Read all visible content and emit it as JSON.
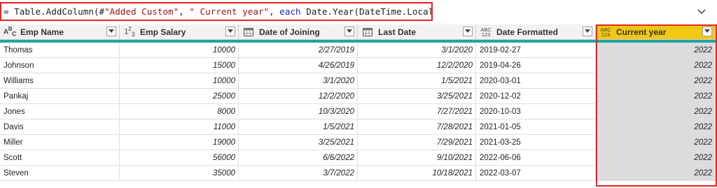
{
  "formula": {
    "prefix": "= Table.AddColumn(#",
    "str1": "\"Added Custom\"",
    "mid1": ", ",
    "str2": "\" Current year\"",
    "mid2": ", ",
    "kw": "each",
    "rest": " Date.Year(DateTime.LocalNow()))",
    "expand_icon": "chevron-down-icon"
  },
  "columns": [
    {
      "label": "Emp Name",
      "type_icon": "ABC",
      "align": "left"
    },
    {
      "label": "Emp Salary",
      "type_icon": "123",
      "align": "right"
    },
    {
      "label": "Date of Joining",
      "type_icon": "calendar",
      "align": "right"
    },
    {
      "label": "Last Date",
      "type_icon": "calendar",
      "align": "right"
    },
    {
      "label": "Date Formatted",
      "type_icon": "ABC123",
      "align": "left"
    },
    {
      "label": "Current year",
      "type_icon": "ABC123",
      "align": "right",
      "selected": true
    }
  ],
  "rows": [
    [
      "Thomas",
      "10000",
      "2/27/2019",
      "3/1/2020",
      "2019-02-27",
      "2022"
    ],
    [
      "Johnson",
      "15000",
      "4/26/2019",
      "12/2/2020",
      "2019-04-26",
      "2022"
    ],
    [
      "Williams",
      "10000",
      "3/1/2020",
      "1/5/2021",
      "2020-03-01",
      "2022"
    ],
    [
      "Pankaj",
      "25000",
      "12/2/2020",
      "3/25/2021",
      "2020-12-02",
      "2022"
    ],
    [
      "Jones",
      "8000",
      "10/3/2020",
      "7/27/2021",
      "2020-10-03",
      "2022"
    ],
    [
      "Davis",
      "11000",
      "1/5/2021",
      "7/28/2021",
      "2021-01-05",
      "2022"
    ],
    [
      "Miller",
      "19000",
      "3/25/2021",
      "7/29/2021",
      "2021-03-25",
      "2022"
    ],
    [
      "Scott",
      "56000",
      "6/6/2022",
      "9/10/2021",
      "2022-06-06",
      "2022"
    ],
    [
      "Steven",
      "35000",
      "3/7/2022",
      "10/18/2021",
      "2022-03-07",
      "2022"
    ]
  ],
  "colors": {
    "highlight": "#e8231f",
    "selected_header": "#f2c811",
    "accent_bar": "#21a5a0"
  }
}
